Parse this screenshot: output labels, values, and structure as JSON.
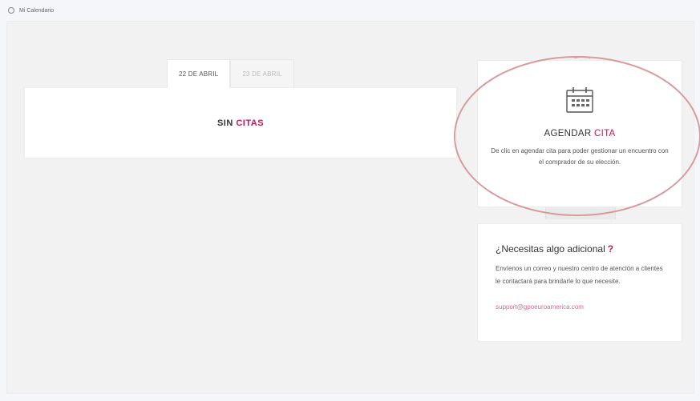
{
  "breadcrumb": {
    "icon": "pin-icon",
    "label": "Mi Calendario"
  },
  "tabs": [
    {
      "label": "22 DE ABRIL",
      "active": true
    },
    {
      "label": "23 DE ABRIL",
      "active": false
    }
  ],
  "citas": {
    "title_main": "SIN",
    "title_accent": "CITAS"
  },
  "agendar": {
    "icon": "calendar-icon",
    "title_main": "AGENDAR",
    "title_accent": "CITA",
    "description": "De clic en agendar cita para poder gestionar un encuentro con el comprador de su elección."
  },
  "help": {
    "title": "¿Necesitas algo adicional",
    "question_mark": "?",
    "text": "Envíenos un correo y nuestro centro de atención a clientes le contactará para brindarle lo que necesite.",
    "email": "support@gpoeuroamerica.com"
  },
  "colors": {
    "accent": "#c2185b",
    "annotation": "#d79b9b"
  }
}
